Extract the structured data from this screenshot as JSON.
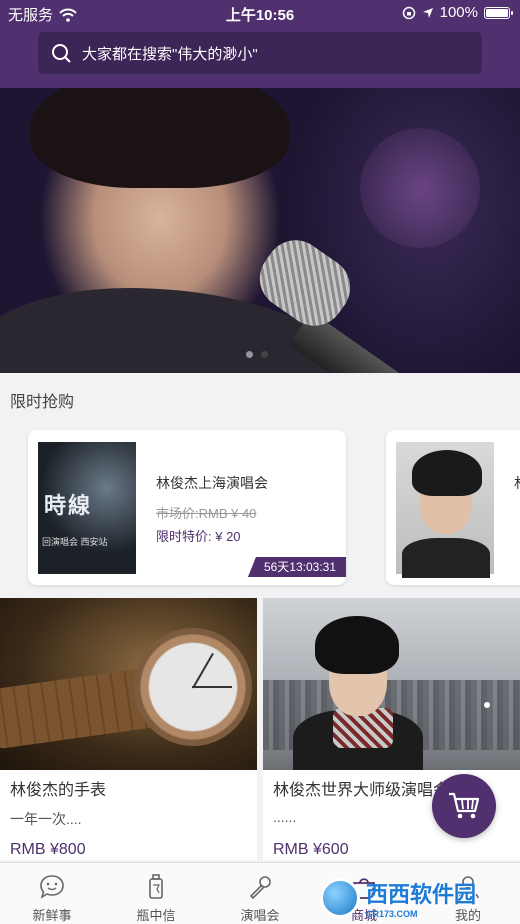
{
  "status_bar": {
    "carrier": "无服务",
    "time": "上午10:56",
    "battery": "100%",
    "battery_level": 1.0
  },
  "search": {
    "placeholder": "大家都在搜索\"伟大的渺小\""
  },
  "banner": {
    "page_count": 2,
    "active_index": 1
  },
  "flash_sale": {
    "title": "限时抢购",
    "items": [
      {
        "name": "林俊杰上海演唱会",
        "market_price": "市场价:RMB ¥ 40",
        "special_price": "限时特价: ¥ 20",
        "countdown": "56天13:03:31",
        "poster_title": "時線",
        "poster_sub": "回演唱会 西安站"
      },
      {
        "name": "林"
      }
    ]
  },
  "products": [
    {
      "name": "林俊杰的手表",
      "desc": "一年一次....",
      "price": "RMB ¥800"
    },
    {
      "name": "林俊杰世界大师级演唱会",
      "desc": "......",
      "price": "RMB ¥600"
    }
  ],
  "tabs": [
    {
      "label": "新鲜事",
      "icon": "chat-bubble-icon"
    },
    {
      "label": "瓶中信",
      "icon": "bottle-icon"
    },
    {
      "label": "演唱会",
      "icon": "microphone-icon"
    },
    {
      "label": "商城",
      "icon": "shop-icon"
    },
    {
      "label": "我的",
      "icon": "user-icon"
    }
  ],
  "active_tab": "商城",
  "watermark": {
    "text": "西西软件园",
    "site": "CR173.COM"
  },
  "colors": {
    "brand": "#50306e"
  }
}
